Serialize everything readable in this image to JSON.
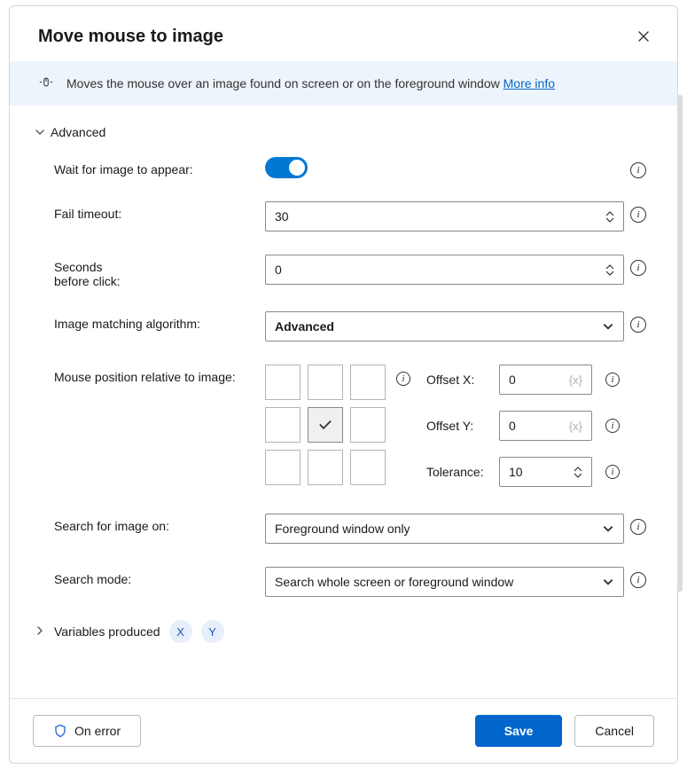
{
  "title": "Move mouse to image",
  "infobar": {
    "text": "Moves the mouse over an image found on screen or on the foreground window",
    "link_label": "More info"
  },
  "sections": {
    "advanced_label": "Advanced",
    "variables_label": "Variables produced"
  },
  "fields": {
    "wait_label": "Wait for image to appear:",
    "wait_value": true,
    "fail_timeout_label": "Fail timeout:",
    "fail_timeout_value": "30",
    "seconds_before_click_label_line1": "Seconds",
    "seconds_before_click_label_line2": "before click:",
    "seconds_before_click_value": "0",
    "algo_label": "Image matching algorithm:",
    "algo_value": "Advanced",
    "pos_label": "Mouse position relative to image:",
    "pos_selected_index": 4,
    "offset_x_label": "Offset X:",
    "offset_x_value": "0",
    "offset_x_placeholder": "{x}",
    "offset_y_label": "Offset Y:",
    "offset_y_value": "0",
    "offset_y_placeholder": "{x}",
    "tolerance_label": "Tolerance:",
    "tolerance_value": "10",
    "search_on_label": "Search for image on:",
    "search_on_value": "Foreground window only",
    "search_mode_label": "Search mode:",
    "search_mode_value": "Search whole screen or foreground window"
  },
  "variables": {
    "items": [
      "X",
      "Y"
    ]
  },
  "footer": {
    "on_error_label": "On error",
    "save_label": "Save",
    "cancel_label": "Cancel"
  }
}
